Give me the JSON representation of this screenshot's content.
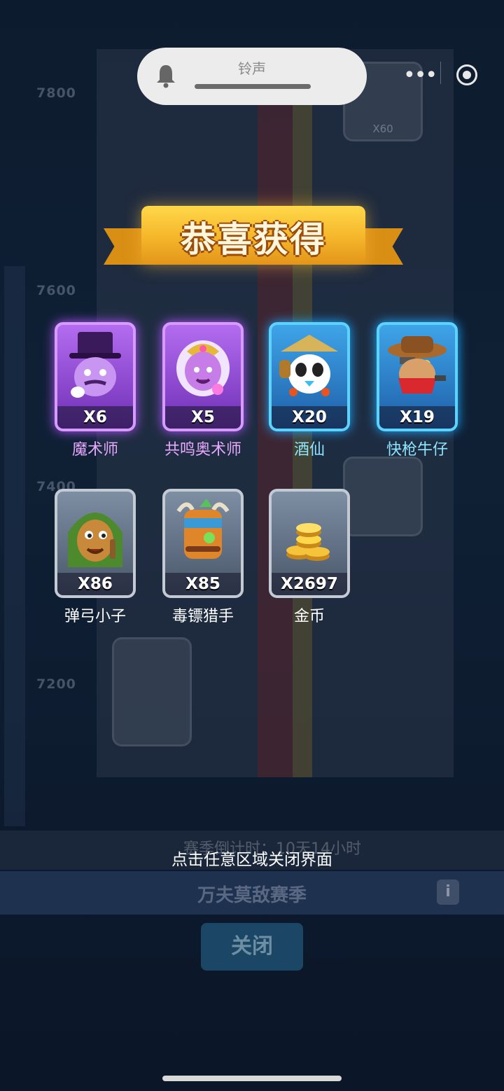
{
  "notification": {
    "title": "铃声",
    "icon": "bell-icon"
  },
  "capsule": {
    "more": "•••",
    "target_icon": "target-icon"
  },
  "background": {
    "levels": [
      "7800",
      "7600",
      "7400",
      "7200"
    ],
    "ghost_badge": "X60",
    "season_timer": "赛季倒计时：10天14小时",
    "season_title": "万夫莫敌赛季",
    "info_label": "i"
  },
  "banner": {
    "title": "恭喜获得"
  },
  "rewards": [
    {
      "name": "魔术师",
      "qty": "X6",
      "rarity": "purple"
    },
    {
      "name": "共鸣奥术师",
      "qty": "X5",
      "rarity": "purple"
    },
    {
      "name": "酒仙",
      "qty": "X20",
      "rarity": "blue"
    },
    {
      "name": "快枪牛仔",
      "qty": "X19",
      "rarity": "blue"
    },
    {
      "name": "弹弓小子",
      "qty": "X86",
      "rarity": "gray"
    },
    {
      "name": "毒镖猎手",
      "qty": "X85",
      "rarity": "gray"
    },
    {
      "name": "金币",
      "qty": "X2697",
      "rarity": "gray"
    }
  ],
  "hint": "点击任意区域关闭界面",
  "close_button": "关闭",
  "colors": {
    "purple": "#b056ff",
    "blue": "#1ea6ff",
    "gold": "#f5b52a"
  }
}
